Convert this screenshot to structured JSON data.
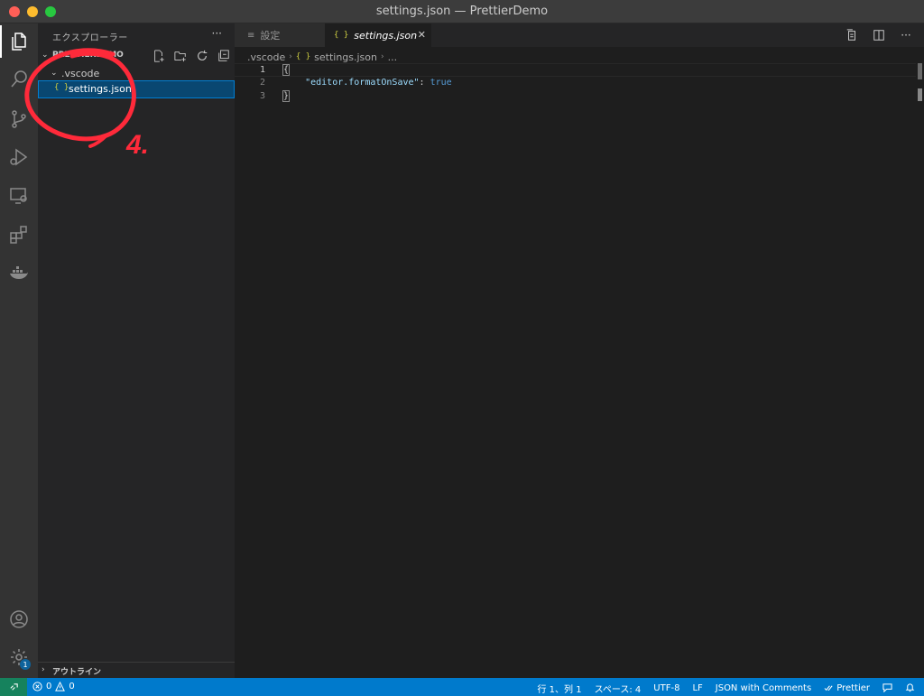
{
  "window": {
    "title": "settings.json — PrettierDemo"
  },
  "sidebar": {
    "title": "エクスプローラー",
    "more": "···",
    "folder": "PRETTIERDEMO",
    "tree": [
      {
        "label": ".vscode"
      },
      {
        "label": "settings.json",
        "icon": "{ }"
      }
    ],
    "outline": "アウトライン"
  },
  "annotation": {
    "label": "4."
  },
  "tabs": [
    {
      "label": "設定",
      "icon": "≡"
    },
    {
      "label": "settings.json",
      "icon": "{ }",
      "close": "✕"
    }
  ],
  "breadcrumb": {
    "folder": ".vscode",
    "file_icon": "{ }",
    "file": "settings.json",
    "tail": "..."
  },
  "editor": {
    "lines": [
      {
        "number": "1"
      },
      {
        "number": "2"
      },
      {
        "number": "3"
      }
    ],
    "open_brace": "{",
    "indent": "    ",
    "key": "\"editor.formatOnSave\"",
    "colon": ": ",
    "value": "true",
    "close_brace": "}"
  },
  "activity": {
    "badge": "1"
  },
  "statusbar": {
    "errors": "0",
    "warnings": "0",
    "position": "行 1、列 1",
    "spaces": "スペース: 4",
    "encoding": "UTF-8",
    "eol": "LF",
    "language": "JSON with Comments",
    "prettier": "Prettier"
  },
  "colors": {
    "accent": "#007acc",
    "remote": "#16825d",
    "annotation": "#ff2a3a"
  }
}
